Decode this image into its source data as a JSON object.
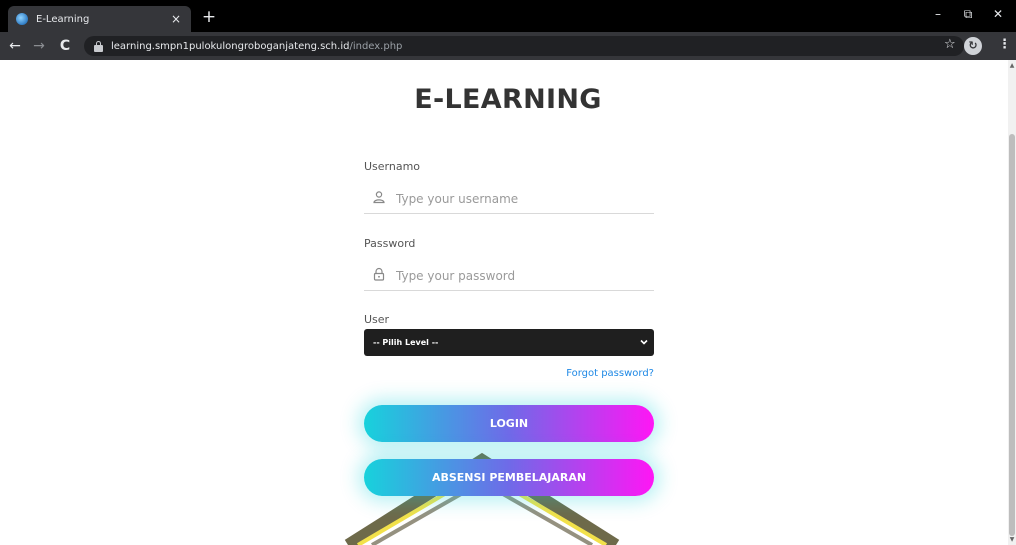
{
  "browser": {
    "tab_title": "E-Learning",
    "tab_close": "×",
    "new_tab": "+",
    "url_host": "learning.smpn1pulokulongroboganjateng.sch.id",
    "url_path": "/index.php",
    "window_controls": {
      "minimize": "–",
      "restore": "⧉",
      "close": "✕"
    },
    "nav": {
      "back": "←",
      "forward": "→",
      "reload": "C"
    },
    "star": "☆",
    "menu": "⋮",
    "icons": [
      "favicon-icon",
      "lock-icon",
      "bookmark-star-icon",
      "extension-icon",
      "menu-icon"
    ]
  },
  "page": {
    "title": "E-LEARNING",
    "username": {
      "label": "Usernamo",
      "placeholder": "Type your username",
      "icon": "user-icon"
    },
    "password": {
      "label": "Password",
      "placeholder": "Type your password",
      "icon": "lock-icon"
    },
    "user_level": {
      "label": "User",
      "selected": "-- Pilih Level --",
      "icon": "chevron-down-icon"
    },
    "forgot_password": "Forgot password?",
    "login_button": "LOGIN",
    "attendance_button": "ABSENSI PEMBELAJARAN",
    "colors": {
      "gradient_start": "#17d2dc",
      "gradient_end": "#ff16f5",
      "link": "#1e88e5",
      "select_bg": "#1f1f1f",
      "title": "#333333"
    }
  }
}
